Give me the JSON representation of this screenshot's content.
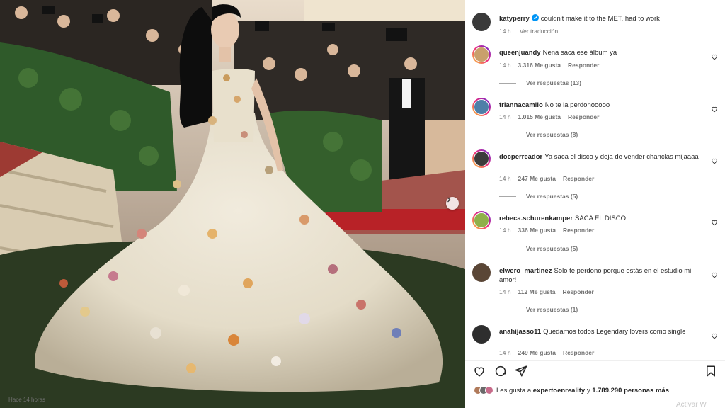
{
  "post": {
    "author": "katyperry",
    "caption": "couldn't make it to the MET, had to work",
    "time": "14 h",
    "translate_label": "Ver traducción"
  },
  "comments": [
    {
      "user": "queenjuandy",
      "text": "Nena saca ese álbum ya",
      "time": "14 h",
      "likes": "3.316 Me gusta",
      "reply": "Responder",
      "replies": "Ver respuestas (13)",
      "avatar_color": "#c9a06b"
    },
    {
      "user": "triannacamilo",
      "text": "No te la perdonooooo",
      "time": "14 h",
      "likes": "1.015 Me gusta",
      "reply": "Responder",
      "replies": "Ver respuestas (8)",
      "avatar_color": "#4f7fa8"
    },
    {
      "user": "docperreador",
      "text": "Ya saca el disco y deja de vender chanclas mijaaaa",
      "time": "14 h",
      "likes": "247 Me gusta",
      "reply": "Responder",
      "replies": "Ver respuestas (5)",
      "avatar_color": "#3b3b3b"
    },
    {
      "user": "rebeca.schurenkamper",
      "text": "SACA EL DISCO",
      "time": "14 h",
      "likes": "336 Me gusta",
      "reply": "Responder",
      "replies": "Ver respuestas (5)",
      "avatar_color": "#8fb04a"
    },
    {
      "user": "elwero_martinez",
      "text": "Solo te perdono porque estás en el estudio mi amor!",
      "time": "14 h",
      "likes": "112 Me gusta",
      "reply": "Responder",
      "replies": "Ver respuestas (1)",
      "avatar_color": "#5a4636"
    },
    {
      "user": "anahijasso11",
      "text": "Quedamos todos Legendary lovers como single",
      "time": "14 h",
      "likes": "249 Me gusta",
      "reply": "Responder",
      "avatar_color": "#2e2e2e"
    }
  ],
  "likes": {
    "prefix": "Les gusta a",
    "user": "expertoenreality",
    "connector": "y",
    "count": "1.789.290 personas más"
  },
  "posted_ago": "Hace 14 horas",
  "watermark": "Activar W",
  "colors": {
    "verified": "#0095f6",
    "muted": "#737373",
    "text": "#262626"
  },
  "icons": [
    "verified-icon",
    "heart-icon",
    "comment-icon",
    "share-icon",
    "bookmark-icon",
    "chevron-right-icon"
  ]
}
